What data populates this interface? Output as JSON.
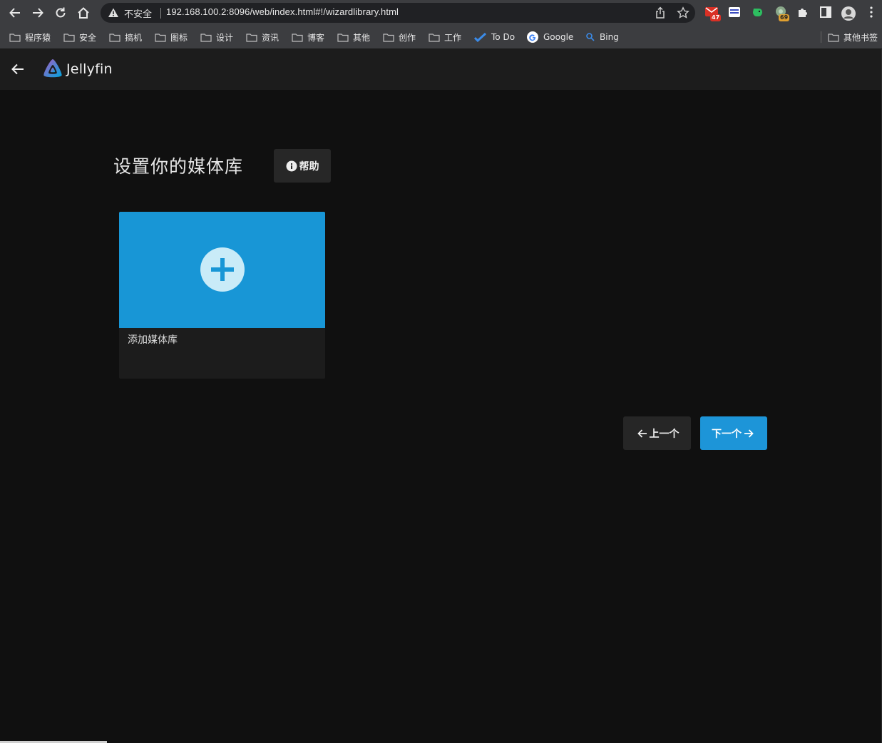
{
  "browser": {
    "insecure_label": "不安全",
    "url": "192.168.100.2:8096/web/index.html#!/wizardlibrary.html",
    "gmail_badge": "47",
    "ext_badge": "69",
    "bookmarks": [
      {
        "label": "程序猿",
        "icon": "folder-icon"
      },
      {
        "label": "安全",
        "icon": "folder-icon"
      },
      {
        "label": "搞机",
        "icon": "folder-icon"
      },
      {
        "label": "图标",
        "icon": "folder-icon"
      },
      {
        "label": "设计",
        "icon": "folder-icon"
      },
      {
        "label": "资讯",
        "icon": "folder-icon"
      },
      {
        "label": "博客",
        "icon": "folder-icon"
      },
      {
        "label": "其他",
        "icon": "folder-icon"
      },
      {
        "label": "创作",
        "icon": "folder-icon"
      },
      {
        "label": "工作",
        "icon": "folder-icon"
      },
      {
        "label": "To Do",
        "icon": "todo-icon"
      },
      {
        "label": "Google",
        "icon": "google-icon"
      },
      {
        "label": "Bing",
        "icon": "search-icon"
      }
    ],
    "other_bookmarks": "其他书签"
  },
  "app": {
    "brand": "Jellyfin",
    "page_title": "设置你的媒体库",
    "help_label": "帮助",
    "add_library_label": "添加媒体库",
    "prev_label": "上一个",
    "next_label": "下一个"
  },
  "colors": {
    "accent": "#1d95d8",
    "background": "#101010",
    "header": "#1c1c1c"
  }
}
